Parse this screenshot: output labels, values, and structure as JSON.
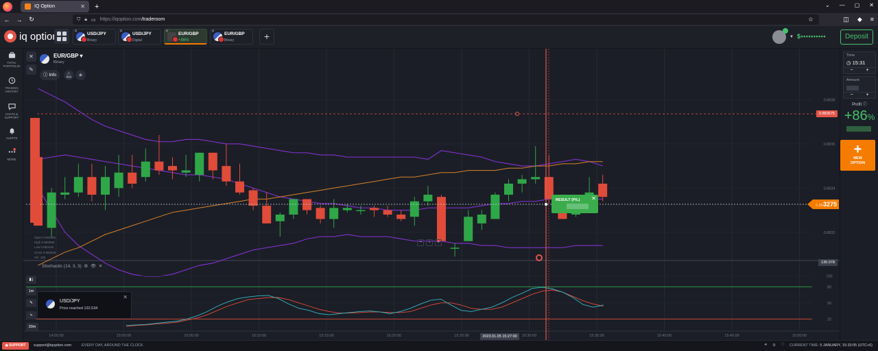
{
  "browser": {
    "tab_title": "IQ Option",
    "url_host": "https://iqoption.com",
    "url_path": "/traderoom"
  },
  "header": {
    "logo_text": "iq option",
    "tabs": [
      {
        "pair": "USD/JPY",
        "sub": "Binary"
      },
      {
        "pair": "USD/JPY",
        "sub": "Digital"
      },
      {
        "pair": "EUR/GBP",
        "sub": "+86%",
        "active": true
      },
      {
        "pair": "EUR/GBP",
        "sub": "Binary"
      }
    ],
    "add_tab": "+",
    "balance": "$••••••••••",
    "deposit": "Deposit"
  },
  "leftnav": {
    "items": [
      {
        "label1": "TOTAL",
        "label2": "PORTFOLIO"
      },
      {
        "label1": "TRADING",
        "label2": "HISTORY"
      },
      {
        "label1": "CHATS &",
        "label2": "SUPPORT"
      },
      {
        "label1": "ALERTS",
        "label2": ""
      },
      {
        "label1": "MORE",
        "label2": ""
      }
    ]
  },
  "asset": {
    "pair": "EUR/GBP ▾",
    "type": "Binary",
    "info": "Info"
  },
  "chart": {
    "ohlc": [
      "Open  0.883566",
      "High  0.883558",
      "Low   0.883445",
      "Close 0.883525",
      "Vol.  155"
    ],
    "price_ticks": [
      "0.8838",
      "0.8836",
      "0.8834",
      "0.8832"
    ],
    "current_price_small": "0.88",
    "current_price": "3275",
    "max_tag": "0.883675",
    "stoch_label": "Stochastic (14, 3, 3)",
    "stoch_tag": "130.078",
    "stoch_ticks": [
      "100",
      "80",
      "50",
      "20"
    ],
    "time_ticks": [
      "14:55:00",
      "15:00:00",
      "15:05:00",
      "15:10:00",
      "15:15:00",
      "15:20:00",
      "15:25:00",
      "15:30:00",
      "15:35:00",
      "15:40:00",
      "15:45:00",
      "15:50:00"
    ],
    "time_tag": "2023.01.05 15:27:00",
    "result_label": "RESULT (P/L)",
    "timeframes": [
      "1m",
      "30m"
    ]
  },
  "chart_data": {
    "type": "candlestick",
    "colors": {
      "up": "#2fa748",
      "down": "#e04b3a",
      "upper_band": "#7b2fc4",
      "ma": "#d9822b",
      "stoch_k": "#35b7c4",
      "stoch_d": "#e04b3a"
    },
    "candles": [
      {
        "o": 0.88354,
        "c": 0.88323,
        "h": 0.88354,
        "l": 0.88323
      },
      {
        "o": 0.88322,
        "c": 0.88338,
        "h": 0.8834,
        "l": 0.88318
      },
      {
        "o": 0.88337,
        "c": 0.88338,
        "h": 0.88345,
        "l": 0.88335
      },
      {
        "o": 0.88338,
        "c": 0.88345,
        "h": 0.88351,
        "l": 0.88336
      },
      {
        "o": 0.88345,
        "c": 0.88337,
        "h": 0.88351,
        "l": 0.88334
      },
      {
        "o": 0.88337,
        "c": 0.88345,
        "h": 0.8835,
        "l": 0.8833
      },
      {
        "o": 0.8834,
        "c": 0.88347,
        "h": 0.88355,
        "l": 0.88336
      },
      {
        "o": 0.88347,
        "c": 0.88342,
        "h": 0.88355,
        "l": 0.8834
      },
      {
        "o": 0.88345,
        "c": 0.88352,
        "h": 0.88358,
        "l": 0.88343
      },
      {
        "o": 0.88352,
        "c": 0.88348,
        "h": 0.88364,
        "l": 0.88346
      },
      {
        "o": 0.8835,
        "c": 0.88348,
        "h": 0.88354,
        "l": 0.88344
      },
      {
        "o": 0.88347,
        "c": 0.88348,
        "h": 0.88355,
        "l": 0.88345
      },
      {
        "o": 0.88346,
        "c": 0.88356,
        "h": 0.88356,
        "l": 0.88343
      },
      {
        "o": 0.88356,
        "c": 0.88348,
        "h": 0.88356,
        "l": 0.88344
      },
      {
        "o": 0.8835,
        "c": 0.88343,
        "h": 0.8836,
        "l": 0.88341
      },
      {
        "o": 0.88343,
        "c": 0.88338,
        "h": 0.88351,
        "l": 0.88337
      },
      {
        "o": 0.88339,
        "c": 0.88332,
        "h": 0.8834,
        "l": 0.8833
      },
      {
        "o": 0.88332,
        "c": 0.88324,
        "h": 0.88338,
        "l": 0.88324
      },
      {
        "o": 0.88325,
        "c": 0.88328,
        "h": 0.88329,
        "l": 0.88318
      },
      {
        "o": 0.88328,
        "c": 0.88335,
        "h": 0.88335,
        "l": 0.88326
      },
      {
        "o": 0.88335,
        "c": 0.8833,
        "h": 0.88335,
        "l": 0.88328
      },
      {
        "o": 0.88331,
        "c": 0.88326,
        "h": 0.88332,
        "l": 0.88324
      },
      {
        "o": 0.88326,
        "c": 0.88331,
        "h": 0.88335,
        "l": 0.88322
      },
      {
        "o": 0.8833,
        "c": 0.88331,
        "h": 0.88333,
        "l": 0.88329
      },
      {
        "o": 0.8833,
        "c": 0.8833,
        "h": 0.88332,
        "l": 0.88328
      },
      {
        "o": 0.88331,
        "c": 0.8833,
        "h": 0.88332,
        "l": 0.88327
      },
      {
        "o": 0.8833,
        "c": 0.88328,
        "h": 0.88332,
        "l": 0.88327
      },
      {
        "o": 0.88328,
        "c": 0.88326,
        "h": 0.8833,
        "l": 0.88325
      },
      {
        "o": 0.88327,
        "c": 0.88334,
        "h": 0.88336,
        "l": 0.88323
      },
      {
        "o": 0.88334,
        "c": 0.88337,
        "h": 0.88341,
        "l": 0.88332
      },
      {
        "o": 0.88336,
        "c": 0.88316,
        "h": 0.88337,
        "l": 0.88314
      },
      {
        "o": 0.88313,
        "c": 0.88313,
        "h": 0.88315,
        "l": 0.88309
      },
      {
        "o": 0.88316,
        "c": 0.88327,
        "h": 0.8833,
        "l": 0.88316
      },
      {
        "o": 0.88324,
        "c": 0.88328,
        "h": 0.8833,
        "l": 0.88321
      },
      {
        "o": 0.88326,
        "c": 0.88337,
        "h": 0.88338,
        "l": 0.88326
      },
      {
        "o": 0.88337,
        "c": 0.88342,
        "h": 0.88344,
        "l": 0.88334
      },
      {
        "o": 0.88342,
        "c": 0.88344,
        "h": 0.88346,
        "l": 0.88338
      },
      {
        "o": 0.88344,
        "c": 0.88345,
        "h": 0.88359,
        "l": 0.88342
      },
      {
        "o": 0.88345,
        "c": 0.88335,
        "h": 0.88355,
        "l": 0.88333
      },
      {
        "o": 0.88335,
        "c": 0.88326,
        "h": 0.88335,
        "l": 0.88326
      },
      {
        "o": 0.88328,
        "c": 0.8833,
        "h": 0.88337,
        "l": 0.88327
      },
      {
        "o": 0.8833,
        "c": 0.88338,
        "h": 0.88345,
        "l": 0.88329
      },
      {
        "o": 0.88342,
        "c": 0.88336,
        "h": 0.88346,
        "l": 0.88334
      }
    ],
    "upper_band": [
      0.88385,
      0.88382,
      0.88379,
      0.88375,
      0.88371,
      0.88368,
      0.88366,
      0.88364,
      0.88362,
      0.88361,
      0.88361,
      0.88362,
      0.88362,
      0.88361,
      0.8836,
      0.8836,
      0.88359,
      0.88358,
      0.88357,
      0.88356,
      0.88356,
      0.88355,
      0.88355,
      0.88354,
      0.88354,
      0.88354,
      0.88354,
      0.88354,
      0.88354,
      0.88353,
      0.88357,
      0.88356,
      0.88355,
      0.88354,
      0.88352,
      0.88351,
      0.8835,
      0.8835,
      0.88351,
      0.88352,
      0.88353,
      0.88352,
      0.8835
    ],
    "middle_band": [
      0.88353,
      0.88354,
      0.88355,
      0.88354,
      0.88353,
      0.88352,
      0.88351,
      0.8835,
      0.88349,
      0.88348,
      0.88347,
      0.88346,
      0.88346,
      0.88345,
      0.88344,
      0.88342,
      0.8834,
      0.88338,
      0.88336,
      0.88335,
      0.88334,
      0.88333,
      0.88333,
      0.88332,
      0.88331,
      0.88331,
      0.8833,
      0.8833,
      0.8833,
      0.88331,
      0.88331,
      0.88331,
      0.88331,
      0.88332,
      0.88333,
      0.88333,
      0.88334,
      0.88334,
      0.88335,
      0.88335,
      0.88335,
      0.88335,
      0.88335
    ],
    "lower_band": [
      0.8834,
      0.8833,
      0.8832,
      0.88314,
      0.8831,
      0.88306,
      0.88303,
      0.88301,
      0.883,
      0.883,
      0.88301,
      0.88303,
      0.88305,
      0.88306,
      0.88308,
      0.8831,
      0.88312,
      0.88313,
      0.88314,
      0.88315,
      0.88317,
      0.88318,
      0.88318,
      0.88319,
      0.88318,
      0.88318,
      0.88318,
      0.88317,
      0.88316,
      0.88316,
      0.88316,
      0.88315,
      0.88315,
      0.88314,
      0.88314,
      0.88313,
      0.88313,
      0.88313,
      0.88313,
      0.88313,
      0.88314,
      0.88314,
      0.88314
    ],
    "ma": [
      0.88305,
      0.88308,
      0.88311,
      0.88313,
      0.88316,
      0.88319,
      0.88321,
      0.88323,
      0.88325,
      0.88327,
      0.88329,
      0.8833,
      0.88331,
      0.88332,
      0.88333,
      0.88334,
      0.88335,
      0.88335,
      0.88336,
      0.88337,
      0.88338,
      0.88339,
      0.8834,
      0.88341,
      0.88342,
      0.88343,
      0.88344,
      0.88345,
      0.88345,
      0.88346,
      0.88347,
      0.88347,
      0.88348,
      0.88348,
      0.88348,
      0.88349,
      0.88349,
      0.8835,
      0.8835,
      0.88351,
      0.88351,
      0.88352,
      0.88352
    ],
    "price_range": [
      0.8831,
      0.884
    ],
    "stoch_k": [
      8,
      9,
      10,
      12,
      14,
      16,
      20,
      26,
      34,
      44,
      52,
      58,
      61,
      63,
      64,
      58,
      48,
      40,
      36,
      30,
      28,
      30,
      32,
      34,
      35,
      33,
      30,
      34,
      40,
      48,
      55,
      57,
      46,
      36,
      34,
      38,
      42,
      50,
      60,
      68,
      77,
      79,
      76,
      70,
      60,
      47,
      42,
      46
    ],
    "stoch_d": [
      6,
      8,
      9,
      11,
      12,
      14,
      18,
      22,
      28,
      36,
      44,
      50,
      56,
      58,
      60,
      60,
      56,
      50,
      44,
      38,
      34,
      31,
      31,
      32,
      33,
      33,
      32,
      32,
      34,
      40,
      46,
      50,
      50,
      46,
      40,
      38,
      38,
      42,
      50,
      58,
      66,
      72,
      74,
      70,
      62,
      54,
      48,
      44
    ],
    "stoch_range": [
      0,
      120
    ]
  },
  "notification": {
    "title": "USD/JPY",
    "message": "Price reached 132.534"
  },
  "rightpanel": {
    "time_label": "Time",
    "time_value": "15:31",
    "amount_label": "Amount",
    "profit_label": "Profit",
    "profit_value": "+86",
    "profit_unit": "%",
    "new_option_line1": "NEW",
    "new_option_line2": "OPTION"
  },
  "footer": {
    "support_label": "SUPPORT",
    "support_email": "support@iqoption.com",
    "tagline": "EVERY DAY, AROUND THE CLOCK",
    "current_time_label": "CURRENT TIME:",
    "current_time_value": "5 JANUARY, 15:33:05 (UTC+6)"
  }
}
